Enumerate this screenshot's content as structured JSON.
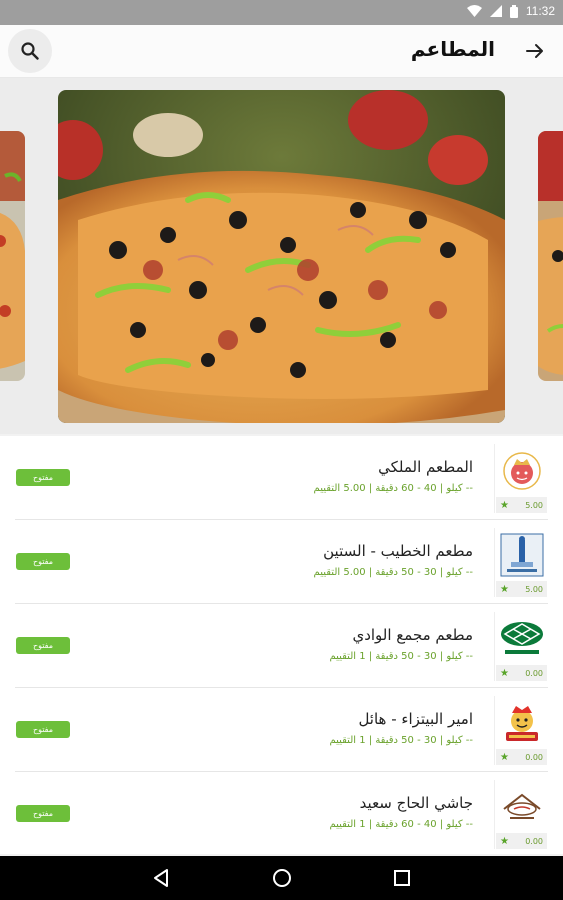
{
  "status_bar": {
    "time": "11:32",
    "icons": [
      "wifi-icon",
      "signal-icon",
      "battery-icon"
    ]
  },
  "app_bar": {
    "title": "المطاعم",
    "search_icon": "search-icon",
    "back_icon": "arrow-right-icon"
  },
  "carousel": {
    "slides": [
      "pizza-photo-left",
      "pizza-photo-main",
      "pizza-photo-right"
    ]
  },
  "restaurants": [
    {
      "name": "المطعم الملكي",
      "meta": "-- كيلو | 40 - 60 دقيقة | 5.00 التقييم",
      "rating": "5.00",
      "status": "مفتوح",
      "logo": "royal-chef-logo"
    },
    {
      "name": "مطعم الخطيب - الستين",
      "meta": "-- كيلو | 30 - 50 دقيقة | 5.00 التقييم",
      "rating": "5.00",
      "status": "مفتوح",
      "logo": "alkhatib-logo"
    },
    {
      "name": "مطعم مجمع الوادي",
      "meta": "-- كيلو | 30 - 50 دقيقة | 1 التقييم",
      "rating": "0.00",
      "status": "مفتوح",
      "logo": "alwadi-logo"
    },
    {
      "name": "امير البيتزاء - هائل",
      "meta": "-- كيلو | 30 - 50 دقيقة | 1 التقييم",
      "rating": "0.00",
      "status": "مفتوح",
      "logo": "pizza-prince-logo"
    },
    {
      "name": "جاشي الحاج سعيد",
      "meta": "-- كيلو | 40 - 60 دقيقة | 1 التقييم",
      "rating": "0.00",
      "status": "مفتوح",
      "logo": "jashi-logo"
    }
  ],
  "colors": {
    "accent_green": "#6dbf3a",
    "meta_green": "#6aa22c",
    "status_bar": "#9e9e9e"
  },
  "nav_bar": {
    "icons": [
      "back-triangle-icon",
      "home-circle-icon",
      "recents-square-icon"
    ]
  }
}
